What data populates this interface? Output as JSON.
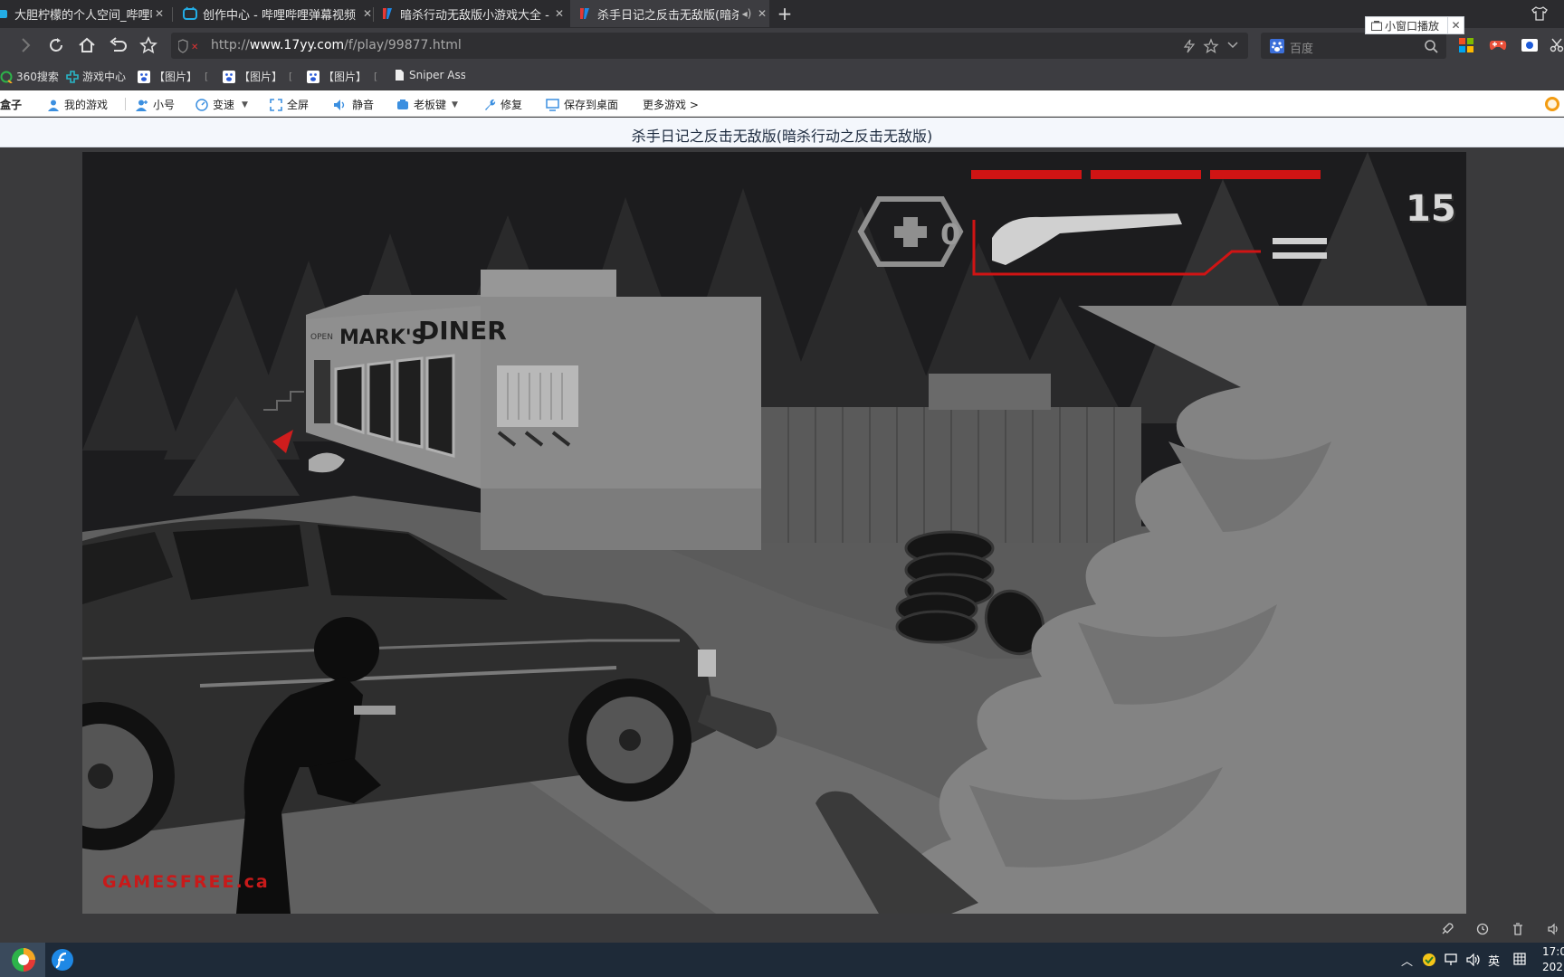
{
  "tabs": [
    {
      "title": "大胆柠檬的个人空间_哔哩哔哩",
      "icon": "bilibili-icon",
      "active": false
    },
    {
      "title": "创作中心 - 哔哩哔哩弹幕视频",
      "icon": "bilibili-tv-icon",
      "active": false
    },
    {
      "title": "暗杀行动无敌版小游戏大全 -",
      "icon": "17yy-icon",
      "active": false
    },
    {
      "title": "杀手日记之反击无敌版(暗杀",
      "icon": "17yy-icon",
      "active": true
    }
  ],
  "address_bar": {
    "prefix": "http://",
    "domain": "www.17yy.com",
    "path": "/f/play/99877.html"
  },
  "search_box": {
    "placeholder": "百度"
  },
  "bookmarks": [
    {
      "label": "360搜索",
      "icon": "search-360-icon"
    },
    {
      "label": "游戏中心",
      "icon": "game-center-icon"
    },
    {
      "label": "【图片】",
      "icon": "baidu-paw-icon"
    },
    {
      "label": "【图片】",
      "icon": "baidu-paw-icon"
    },
    {
      "label": "【图片】",
      "icon": "baidu-paw-icon"
    },
    {
      "label": "Sniper Ass",
      "icon": "page-icon"
    }
  ],
  "game_toolbar": {
    "box_label": "盒子",
    "items": [
      {
        "label": "我的游戏",
        "icon": "user-icon"
      },
      {
        "label": "小号",
        "icon": "add-user-icon"
      },
      {
        "label": "变速",
        "icon": "speed-icon"
      },
      {
        "label": "全屏",
        "icon": "fullscreen-icon"
      },
      {
        "label": "静音",
        "icon": "speaker-icon"
      },
      {
        "label": "老板键",
        "icon": "boss-key-icon"
      },
      {
        "label": "修复",
        "icon": "wrench-icon"
      },
      {
        "label": "保存到桌面",
        "icon": "monitor-icon"
      },
      {
        "label": "更多游戏 >",
        "icon": ""
      }
    ]
  },
  "game_title": "杀手日记之反击无敌版(暗杀行动之反击无敌版)",
  "mini_window": {
    "label": "小窗口播放",
    "close": "✕"
  },
  "game": {
    "health_segments": 3,
    "medkit_count": "0",
    "ammo_count": "15",
    "brand": "GAMESFREE.ca",
    "sign_left": "MARK'S",
    "sign_right": "DINER",
    "door_sign": "OPEN"
  },
  "taskbar": {
    "ime": "英",
    "clock_time": "17:0",
    "clock_date": "202"
  },
  "colors": {
    "hud_red": "#d01414",
    "accent_blue": "#1e88e5",
    "tab_active": "#3d3d41"
  }
}
